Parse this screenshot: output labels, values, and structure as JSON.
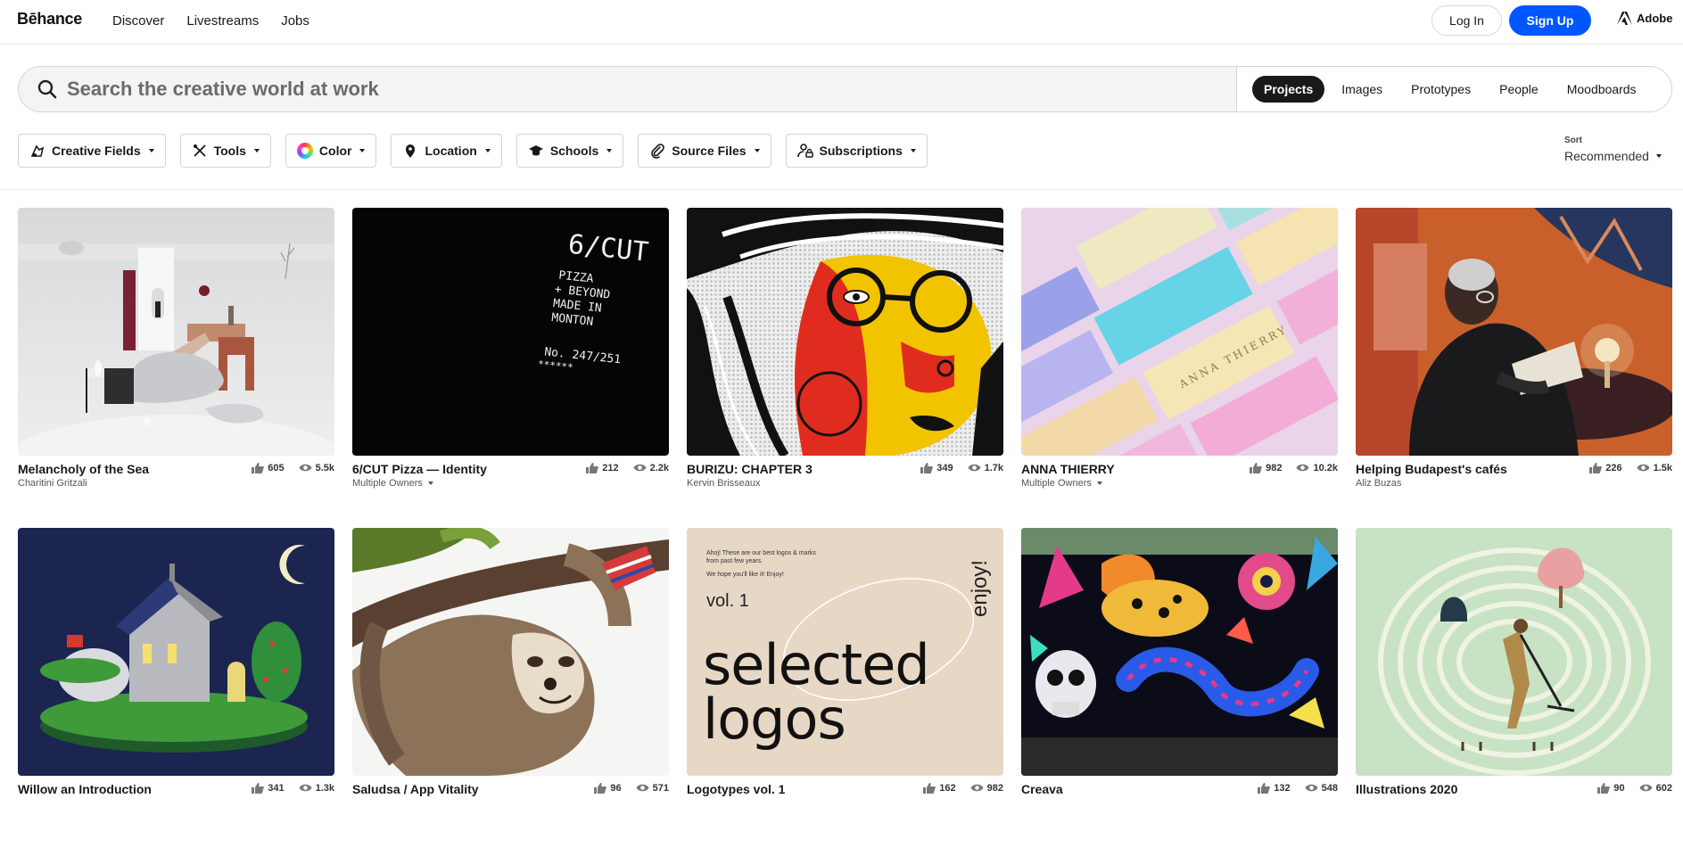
{
  "header": {
    "logo": "Bēhance",
    "nav": [
      "Discover",
      "Livestreams",
      "Jobs"
    ],
    "login_label": "Log In",
    "signup_label": "Sign Up",
    "adobe_label": "Adobe",
    "colors": {
      "signup_bg": "#0057ff"
    }
  },
  "search": {
    "placeholder": "Search the creative world at work",
    "tabs": [
      "Projects",
      "Images",
      "Prototypes",
      "People",
      "Moodboards"
    ],
    "active_tab": "Projects"
  },
  "filters": [
    {
      "label": "Creative Fields",
      "icon": "creative-fields-icon"
    },
    {
      "label": "Tools",
      "icon": "tools-icon"
    },
    {
      "label": "Color",
      "icon": "color-wheel-icon"
    },
    {
      "label": "Location",
      "icon": "location-pin-icon"
    },
    {
      "label": "Schools",
      "icon": "graduation-cap-icon"
    },
    {
      "label": "Source Files",
      "icon": "paperclip-icon"
    },
    {
      "label": "Subscriptions",
      "icon": "subscriptions-icon"
    }
  ],
  "sort": {
    "label": "Sort",
    "value": "Recommended"
  },
  "projects": [
    {
      "title": "Melancholy of the Sea",
      "owner": "Charitini Gritzali",
      "owner_dropdown": false,
      "likes": "605",
      "views": "5.5k",
      "art": "surreal-white"
    },
    {
      "title": "6/CUT Pizza — Identity",
      "owner": "Multiple Owners",
      "owner_dropdown": true,
      "likes": "212",
      "views": "2.2k",
      "art": "black-type",
      "art_text": [
        "6/CUT",
        "PIZZA",
        "+ BEYOND",
        "MADE IN",
        "MONTON",
        "No. 247/251",
        "******"
      ]
    },
    {
      "title": "BURIZU: CHAPTER 3",
      "owner": "Kervin Brisseaux",
      "owner_dropdown": false,
      "likes": "349",
      "views": "1.7k",
      "art": "comic-face"
    },
    {
      "title": "ANNA THIERRY",
      "owner": "Multiple Owners",
      "owner_dropdown": true,
      "likes": "982",
      "views": "10.2k",
      "art": "pastel-boxes",
      "art_text": [
        "ANNA THIERRY"
      ]
    },
    {
      "title": "Helping Budapest's cafés",
      "owner": "Aliz Buzas",
      "owner_dropdown": false,
      "likes": "226",
      "views": "1.5k",
      "art": "reading-man"
    },
    {
      "title": "Willow an Introduction",
      "owner": "",
      "owner_dropdown": false,
      "likes": "341",
      "views": "1.3k",
      "art": "night-house"
    },
    {
      "title": "Saludsa / App Vitality",
      "owner": "",
      "owner_dropdown": false,
      "likes": "96",
      "views": "571",
      "art": "sloth"
    },
    {
      "title": "Logotypes vol. 1",
      "owner": "",
      "owner_dropdown": false,
      "likes": "162",
      "views": "982",
      "art": "selected-logos",
      "art_text": [
        "Ahoj! These are our best logos & marks",
        "from past few years.",
        "We hope you'll like it! Enjoy!",
        "vol. 1",
        "enjoy!",
        "selected",
        "logos"
      ]
    },
    {
      "title": "Creava",
      "owner": "",
      "owner_dropdown": false,
      "likes": "132",
      "views": "548",
      "art": "mural"
    },
    {
      "title": "Illustrations 2020",
      "owner": "",
      "owner_dropdown": false,
      "likes": "90",
      "views": "602",
      "art": "green-maze"
    }
  ]
}
